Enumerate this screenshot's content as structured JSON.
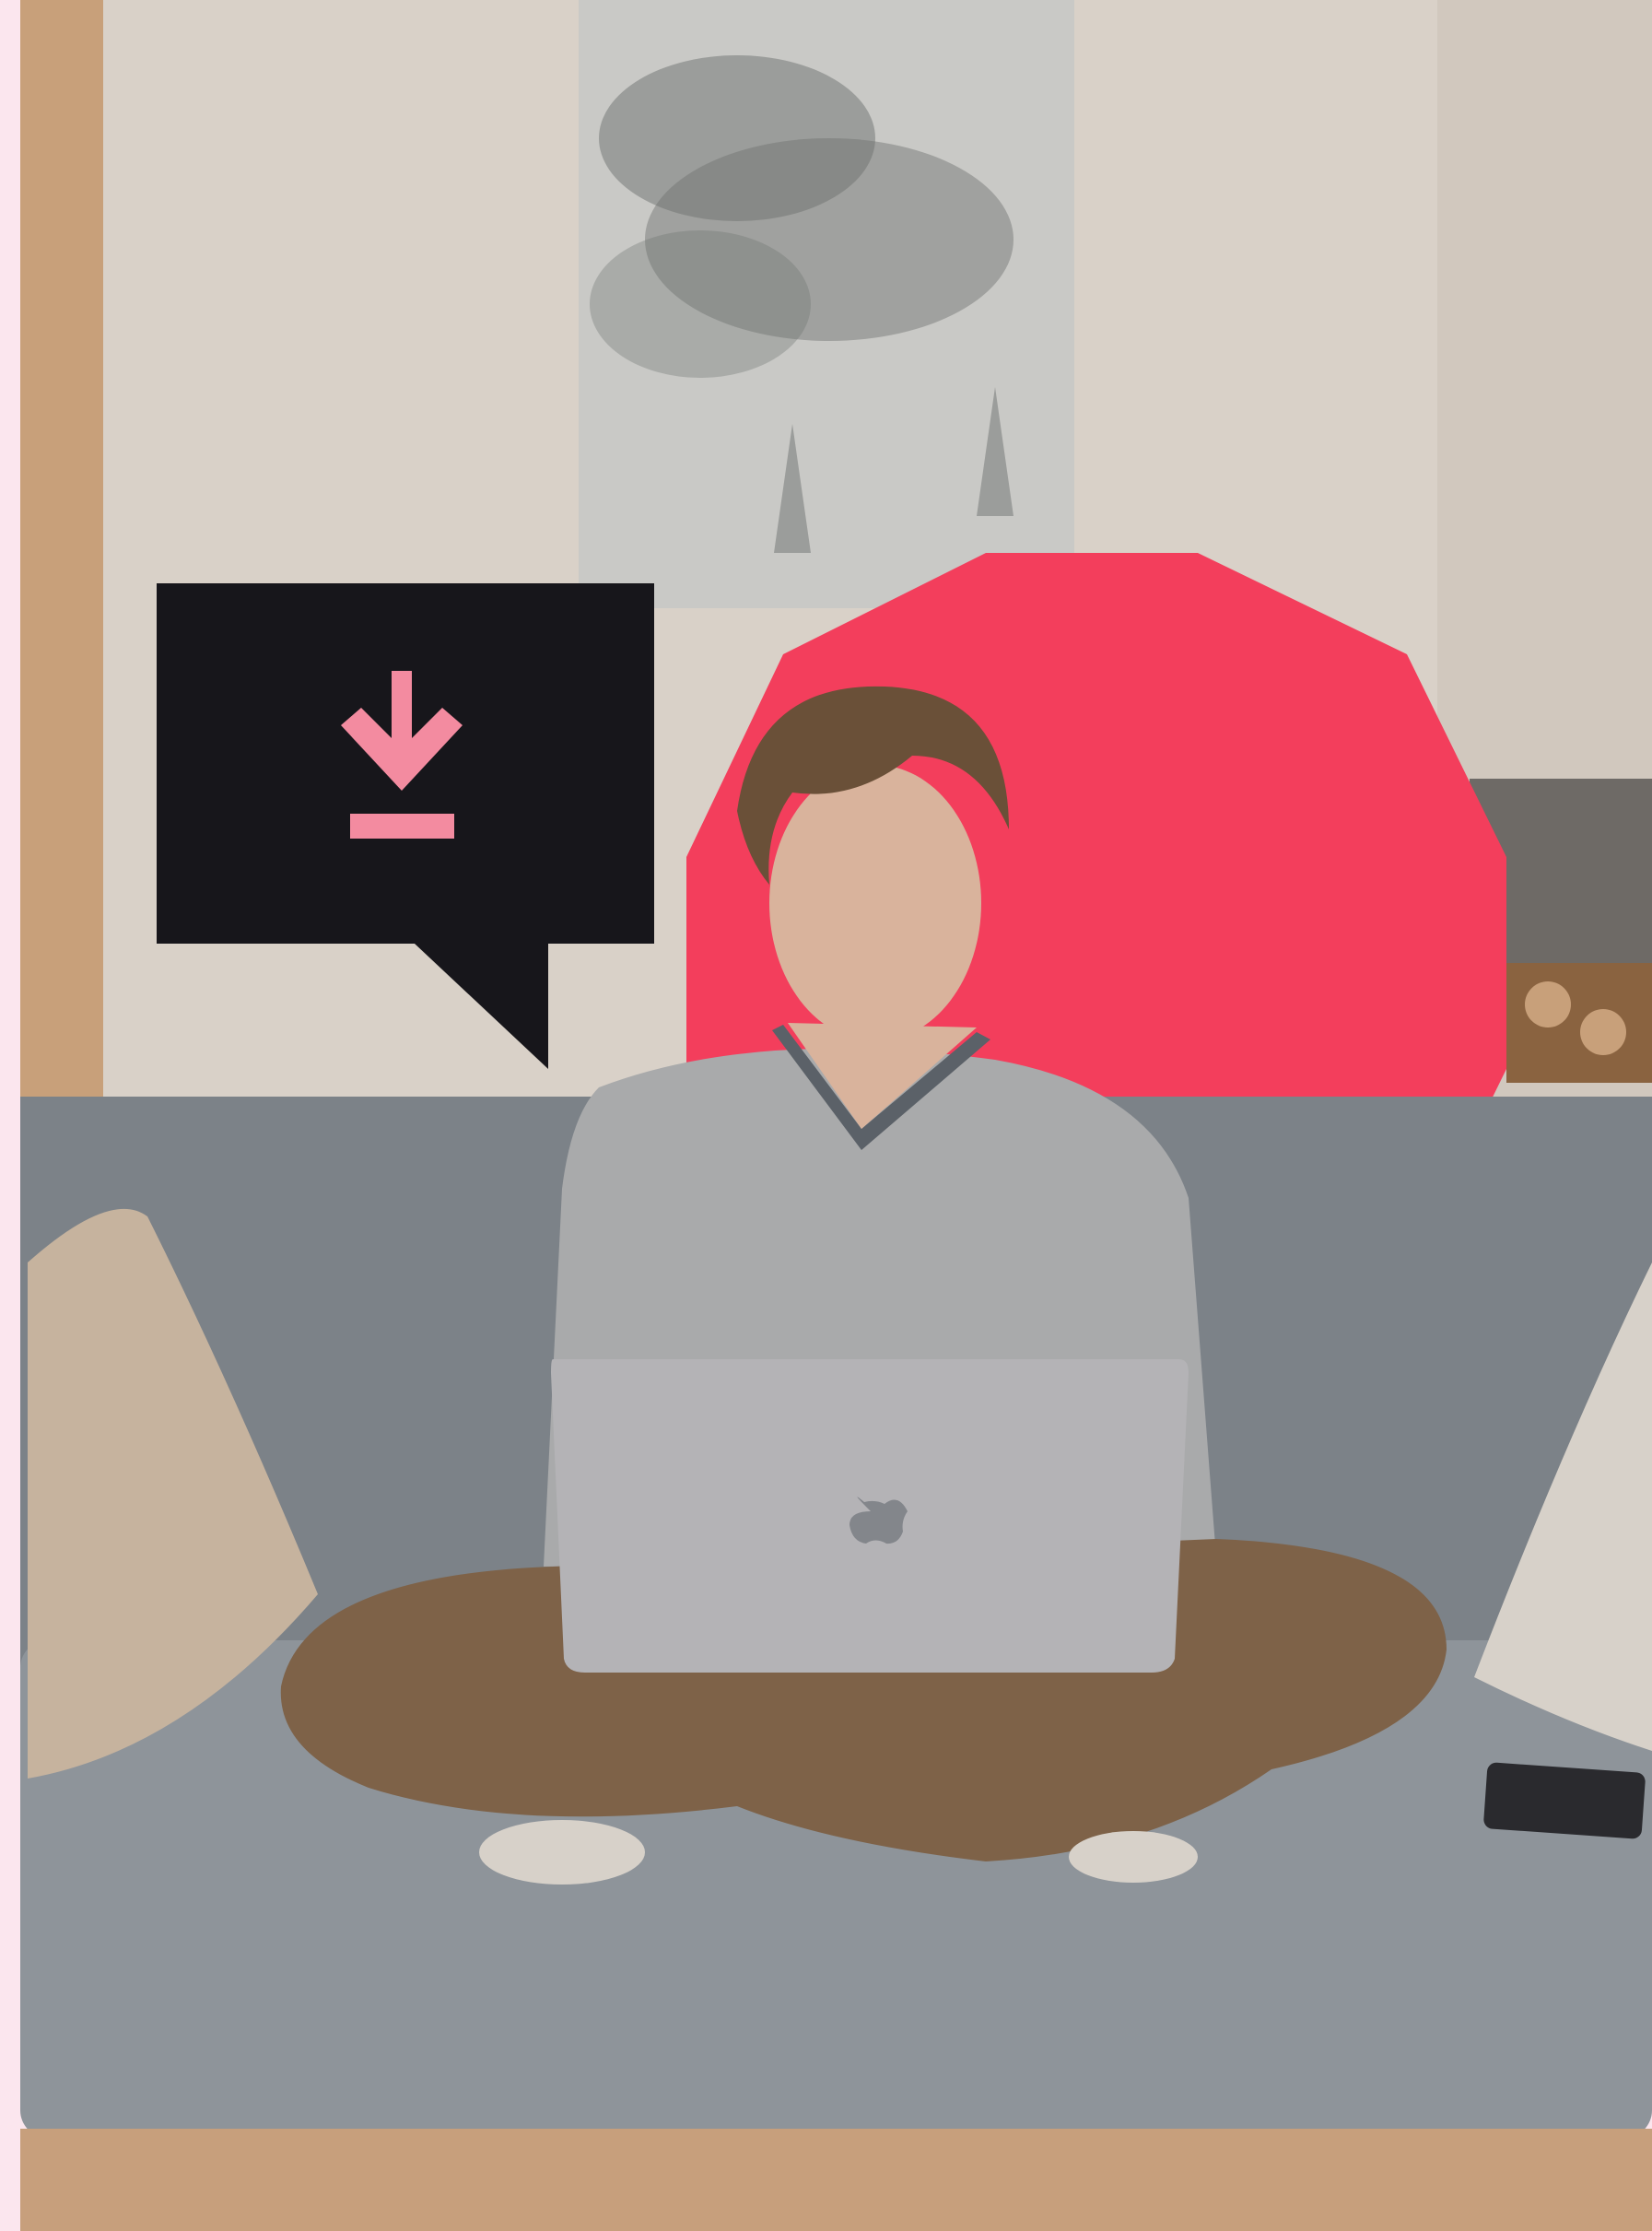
{
  "scene": {
    "description_free": true,
    "colors": {
      "page_edge": "#fbe6ee",
      "wall": "#d9d1c8",
      "wall_shadow": "#cbc2b8",
      "wood_trim": "#c8a07a",
      "painting_bg": "#c9c9c6",
      "painting_ink": "#6e726f",
      "accent_dodecagon": "#f33e5c",
      "bubble": "#17161b",
      "bubble_icon": "#f38ba0",
      "sofa": "#8e949a",
      "sofa_dark": "#7c8288",
      "sofa_base": "#c79f7c",
      "sweater": "#a9aaab",
      "sweater_trim": "#5b6168",
      "pants": "#7e6248",
      "laptop": "#b4b3b6",
      "skin": "#d9b39c",
      "hair": "#6a5038",
      "pillow": "#c6b39e",
      "pillow_right": "#d7d1c9",
      "phone": "#2a2a2e",
      "fireplace": "#6e6a66",
      "logs": "#8a6340"
    },
    "icons": {
      "bubble_icon": "download-icon",
      "laptop_logo": "apple-logo"
    }
  }
}
